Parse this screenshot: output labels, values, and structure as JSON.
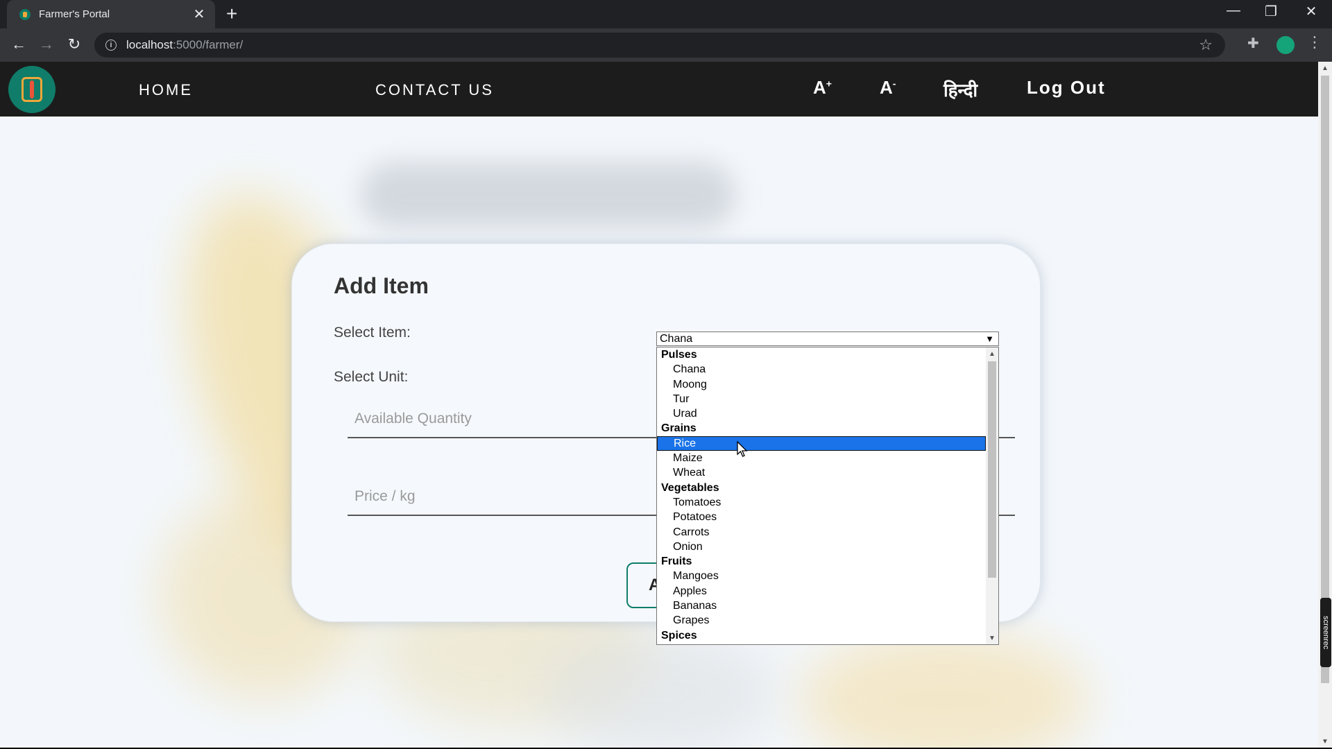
{
  "browser": {
    "tab_title": "Farmer's Portal",
    "tab_close": "✕",
    "new_tab": "+",
    "url_host": "localhost",
    "url_path": ":5000/farmer/",
    "window_controls": [
      "—",
      "❐",
      "✕"
    ]
  },
  "navbar": {
    "home": "HOME",
    "contact": "CONTACT US",
    "font_increase": "A",
    "font_increase_sign": "+",
    "font_decrease": "A",
    "font_decrease_sign": "-",
    "language": "हिन्दी",
    "logout": "Log Out"
  },
  "form": {
    "title": "Add Item",
    "select_item_label": "Select Item:",
    "select_unit_label": "Select Unit:",
    "quantity_placeholder": "Available Quantity",
    "price_placeholder": "Price / kg",
    "submit_visible": "A"
  },
  "item_select": {
    "selected_value": "Chana",
    "highlighted": "Rice",
    "groups": [
      {
        "label": "Pulses",
        "options": [
          "Chana",
          "Moong",
          "Tur",
          "Urad"
        ]
      },
      {
        "label": "Grains",
        "options": [
          "Rice",
          "Maize",
          "Wheat"
        ]
      },
      {
        "label": "Vegetables",
        "options": [
          "Tomatoes",
          "Potatoes",
          "Carrots",
          "Onion"
        ]
      },
      {
        "label": "Fruits",
        "options": [
          "Mangoes",
          "Apples",
          "Bananas",
          "Grapes"
        ]
      },
      {
        "label": "Spices",
        "options": []
      }
    ]
  },
  "watermark": "screenrec",
  "colors": {
    "navbar_bg": "#1c1c1c",
    "accent_green": "#0f7d69",
    "highlight_blue": "#1a73e8"
  }
}
